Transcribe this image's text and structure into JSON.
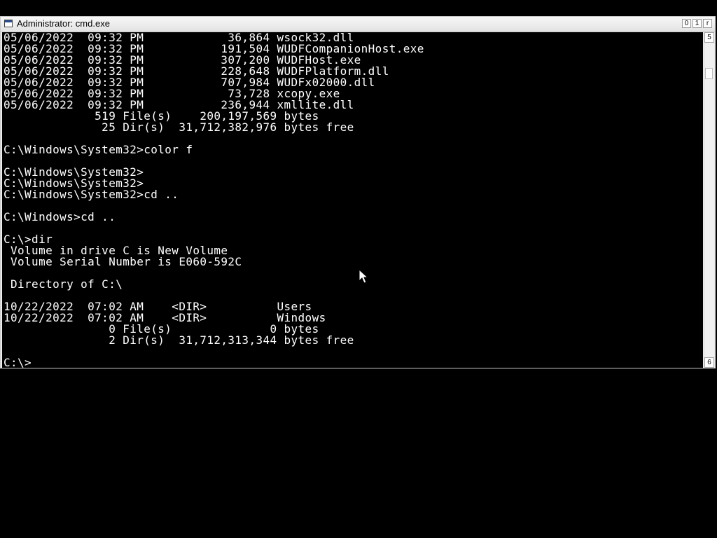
{
  "window": {
    "title": "Administrator: cmd.exe",
    "controls": [
      "0",
      "1",
      "r"
    ]
  },
  "console": {
    "lines": [
      "05/06/2022  09:32 PM            36,864 wsock32.dll",
      "05/06/2022  09:32 PM           191,504 WUDFCompanionHost.exe",
      "05/06/2022  09:32 PM           307,200 WUDFHost.exe",
      "05/06/2022  09:32 PM           228,648 WUDFPlatform.dll",
      "05/06/2022  09:32 PM           707,984 WUDFx02000.dll",
      "05/06/2022  09:32 PM            73,728 xcopy.exe",
      "05/06/2022  09:32 PM           236,944 xmllite.dll",
      "             519 File(s)    200,197,569 bytes",
      "              25 Dir(s)  31,712,382,976 bytes free",
      "",
      "C:\\Windows\\System32>color f",
      "",
      "C:\\Windows\\System32>",
      "C:\\Windows\\System32>",
      "C:\\Windows\\System32>cd ..",
      "",
      "C:\\Windows>cd ..",
      "",
      "C:\\>dir",
      " Volume in drive C is New Volume",
      " Volume Serial Number is E060-592C",
      "",
      " Directory of C:\\",
      "",
      "10/22/2022  07:02 AM    <DIR>          Users",
      "10/22/2022  07:02 AM    <DIR>          Windows",
      "               0 File(s)              0 bytes",
      "               2 Dir(s)  31,712,313,344 bytes free",
      "",
      "C:\\>"
    ]
  },
  "scrollbar": {
    "up_label": "5",
    "down_label": "6"
  },
  "icons": {
    "window_icon": "cmd-window-icon",
    "mouse_cursor": "arrow-cursor-icon"
  }
}
